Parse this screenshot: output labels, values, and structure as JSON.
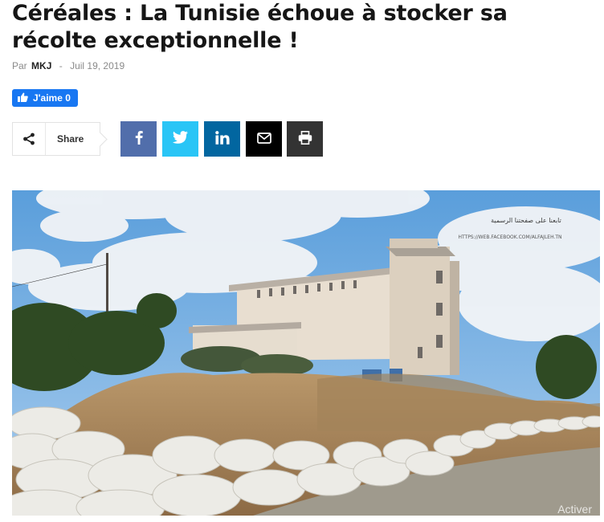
{
  "article": {
    "title": "Céréales : La Tunisie échoue à stocker sa récolte exceptionnelle !",
    "by_label": "Par",
    "author": "MKJ",
    "separator": "-",
    "date": "Juil 19, 2019"
  },
  "facebook": {
    "like_label": "J'aime 0"
  },
  "share": {
    "label": "Share",
    "buttons": [
      {
        "name": "facebook",
        "icon": "facebook-icon",
        "color": "#516eab"
      },
      {
        "name": "twitter",
        "icon": "twitter-icon",
        "color": "#29c5f6"
      },
      {
        "name": "linkedin",
        "icon": "linkedin-icon",
        "color": "#0266a0"
      },
      {
        "name": "email",
        "icon": "envelope-icon",
        "color": "#000000"
      },
      {
        "name": "print",
        "icon": "printer-icon",
        "color": "#333333"
      }
    ]
  },
  "image": {
    "watermark_line1": "تابعنا على صفحتنا الرسمية",
    "watermark_line2": "HTTPS://WEB.FACEBOOK.COM/ALFAJLEH.TN",
    "overlay_text": "Activer"
  }
}
